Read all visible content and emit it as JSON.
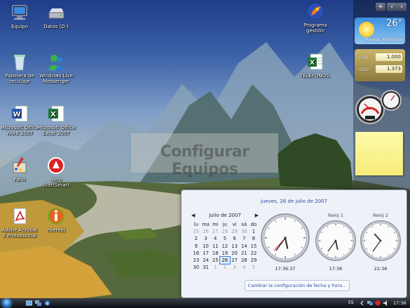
{
  "desktop_icons": [
    {
      "label": "Equipo",
      "icon": "computer-icon"
    },
    {
      "label": "Datos (D:)",
      "icon": "drive-icon"
    },
    {
      "label": "Papelera de reciclaje",
      "icon": "recycle-bin-icon"
    },
    {
      "label": "Windows Live Messenger",
      "icon": "messenger-icon"
    },
    {
      "label": "Microsoft Office Word 2007",
      "icon": "word-icon"
    },
    {
      "label": "Microsoft Office Excel 2007",
      "icon": "excel-icon"
    },
    {
      "label": "Paint",
      "icon": "paint-icon"
    },
    {
      "label": "Nero StartSmart",
      "icon": "nero-icon"
    },
    {
      "label": "Adobe Acrobat 8 Professional",
      "icon": "acrobat-icon"
    },
    {
      "label": "everest",
      "icon": "everest-icon"
    },
    {
      "label": "Programa gestión",
      "icon": "program-icon"
    },
    {
      "label": "TELEFONOS.",
      "icon": "excel-icon"
    }
  ],
  "watermark": "Configurar Equipos",
  "sidebar": {
    "add_label": "+",
    "weather": {
      "temperature": "26°",
      "city": "Málaga, Andalucía"
    },
    "currency": [
      {
        "code": "EUR",
        "value": "1.000"
      },
      {
        "code": "USD",
        "value": "1.373"
      }
    ]
  },
  "calendar_popup": {
    "full_date": "jueves, 26 de julio de 2007",
    "month_label": "julio de 2007",
    "weekdays": [
      "lu",
      "ma",
      "mi",
      "ju",
      "vi",
      "sá",
      "do"
    ],
    "weeks": [
      [
        "25",
        "26",
        "27",
        "28",
        "29",
        "30",
        "1"
      ],
      [
        "2",
        "3",
        "4",
        "5",
        "6",
        "7",
        "8"
      ],
      [
        "9",
        "10",
        "11",
        "12",
        "13",
        "14",
        "15"
      ],
      [
        "16",
        "17",
        "18",
        "19",
        "20",
        "21",
        "22"
      ],
      [
        "23",
        "24",
        "25",
        "26",
        "27",
        "28",
        "29"
      ],
      [
        "30",
        "31",
        "1",
        "2",
        "3",
        "4",
        "5"
      ]
    ],
    "selected_day": "26",
    "clocks": [
      {
        "label": "",
        "time": "17:36:37",
        "hours": 17,
        "minutes": 36,
        "seconds": 37
      },
      {
        "label": "Reloj 1",
        "time": "17:36",
        "hours": 17,
        "minutes": 36,
        "seconds": null
      },
      {
        "label": "Reloj 2",
        "time": "22:36",
        "hours": 22,
        "minutes": 36,
        "seconds": null
      }
    ],
    "change_settings_link": "Cambiar la configuración de fecha y hora..."
  },
  "taskbar": {
    "language": "ES",
    "clock": "17:36"
  }
}
